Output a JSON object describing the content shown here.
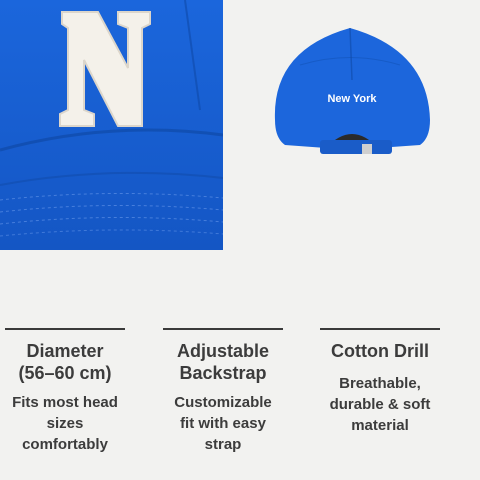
{
  "front_photo": {
    "letter": "N"
  },
  "back_photo": {
    "embroidery": "New York"
  },
  "features": [
    {
      "title_line1": "Diameter",
      "title_line2": "(56–60 cm)",
      "desc_line1": "Fits most head",
      "desc_line2": "sizes",
      "desc_line3": "comfortably"
    },
    {
      "title_line1": "Adjustable",
      "title_line2": "Backstrap",
      "desc_line1": "Customizable",
      "desc_line2": "fit with easy",
      "desc_line3": "strap"
    },
    {
      "title_line1": "Cotton Drill",
      "title_line2": "",
      "desc_line1": "Breathable,",
      "desc_line2": "durable & soft",
      "desc_line3": "material"
    }
  ],
  "colors": {
    "cap_blue": "#1a63d6",
    "background": "#f2f2f0",
    "text": "#3c3c3c"
  }
}
